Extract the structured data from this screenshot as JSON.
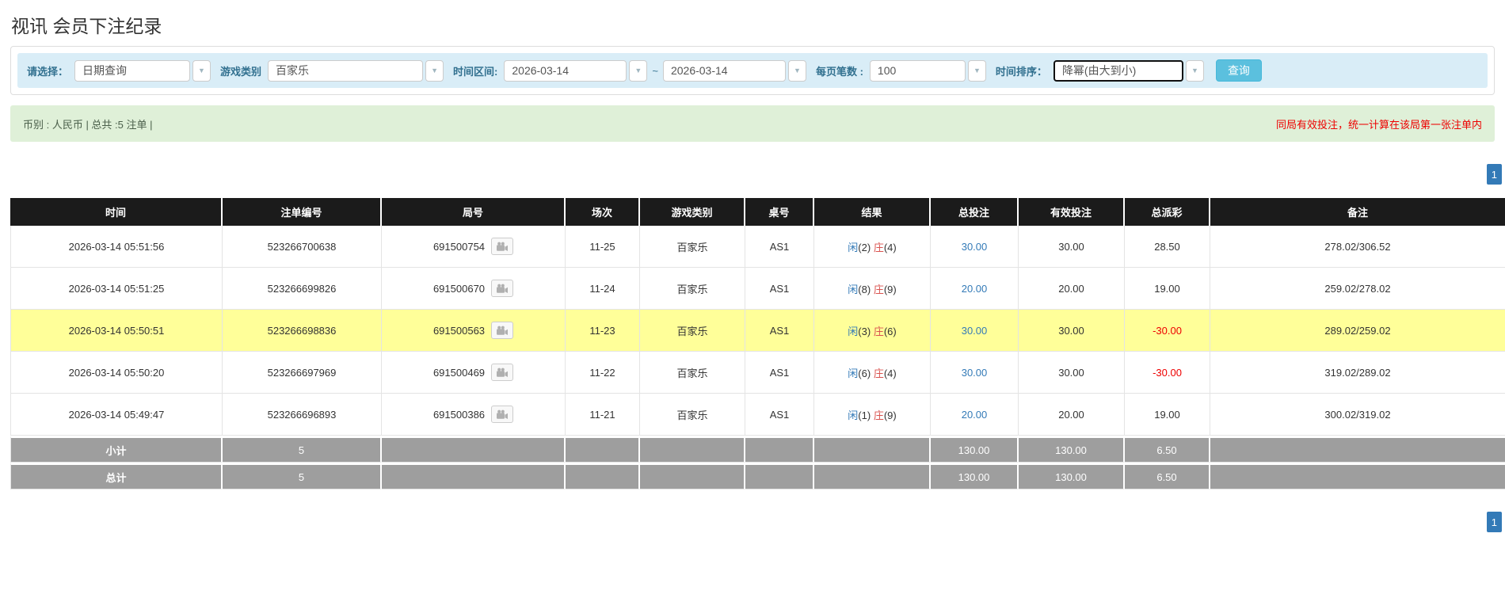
{
  "page": {
    "title": "视讯 会员下注纪录"
  },
  "icons": {
    "caret_down": "▼",
    "video_camera": "video-camera"
  },
  "colors": {
    "accent_blue": "#337ab7",
    "danger_red": "#ee0000",
    "banker_red": "#d9534f",
    "filter_bg": "#d9edf7",
    "summary_bg": "#dff0d8",
    "search_button_cyan": "#5bc0de",
    "highlight_yellow": "#ffff99",
    "header_black": "#1b1b1b",
    "subtotal_gray": "#9e9e9e"
  },
  "filters": {
    "select_label": "请选择：",
    "select_value": "日期查询",
    "game_label": "游戏类别",
    "game_value": "百家乐",
    "range_label": "时间区间:",
    "date_from": "2026-03-14",
    "tilde": "~",
    "date_to": "2026-03-14",
    "page_size_label": "每页笔数 :",
    "page_size_value": "100",
    "sort_label": "时间排序：",
    "sort_value": "降幂(由大到小)",
    "search_button": "查询"
  },
  "summary": {
    "left": "币别 : 人民币 | 总共 :5 注单 |",
    "right": "同局有效投注，统一计算在该局第一张注单内"
  },
  "pagination": {
    "page": "1"
  },
  "table": {
    "headers": [
      "时间",
      "注单编号",
      "局号",
      "场次",
      "游戏类别",
      "桌号",
      "结果",
      "总投注",
      "有效投注",
      "总派彩",
      "备注"
    ],
    "rows": [
      {
        "time": "2026-03-14 05:51:56",
        "bet_id": "523266700638",
        "round_id": "691500754",
        "session": "11-25",
        "game": "百家乐",
        "table_no": "AS1",
        "player": "闲",
        "player_n": "(2)",
        "banker": "庄",
        "banker_n": "(4)",
        "total_bet": "30.00",
        "valid_bet": "30.00",
        "payout": "28.50",
        "note": "278.02/306.52"
      },
      {
        "time": "2026-03-14 05:51:25",
        "bet_id": "523266699826",
        "round_id": "691500670",
        "session": "11-24",
        "game": "百家乐",
        "table_no": "AS1",
        "player": "闲",
        "player_n": "(8)",
        "banker": "庄",
        "banker_n": "(9)",
        "total_bet": "20.00",
        "valid_bet": "20.00",
        "payout": "19.00",
        "note": "259.02/278.02"
      },
      {
        "time": "2026-03-14 05:50:51",
        "bet_id": "523266698836",
        "round_id": "691500563",
        "session": "11-23",
        "game": "百家乐",
        "table_no": "AS1",
        "player": "闲",
        "player_n": "(3)",
        "banker": "庄",
        "banker_n": "(6)",
        "total_bet": "30.00",
        "valid_bet": "30.00",
        "payout": "-30.00",
        "note": "289.02/259.02"
      },
      {
        "time": "2026-03-14 05:50:20",
        "bet_id": "523266697969",
        "round_id": "691500469",
        "session": "11-22",
        "game": "百家乐",
        "table_no": "AS1",
        "player": "闲",
        "player_n": "(6)",
        "banker": "庄",
        "banker_n": "(4)",
        "total_bet": "30.00",
        "valid_bet": "30.00",
        "payout": "-30.00",
        "note": "319.02/289.02"
      },
      {
        "time": "2026-03-14 05:49:47",
        "bet_id": "523266696893",
        "round_id": "691500386",
        "session": "11-21",
        "game": "百家乐",
        "table_no": "AS1",
        "player": "闲",
        "player_n": "(1)",
        "banker": "庄",
        "banker_n": "(9)",
        "total_bet": "20.00",
        "valid_bet": "20.00",
        "payout": "19.00",
        "note": "300.02/319.02"
      }
    ],
    "subtotal": {
      "label": "小计",
      "count": "5",
      "total_bet": "130.00",
      "valid_bet": "130.00",
      "payout": "6.50"
    },
    "total": {
      "label": "总计",
      "count": "5",
      "total_bet": "130.00",
      "valid_bet": "130.00",
      "payout": "6.50"
    }
  }
}
